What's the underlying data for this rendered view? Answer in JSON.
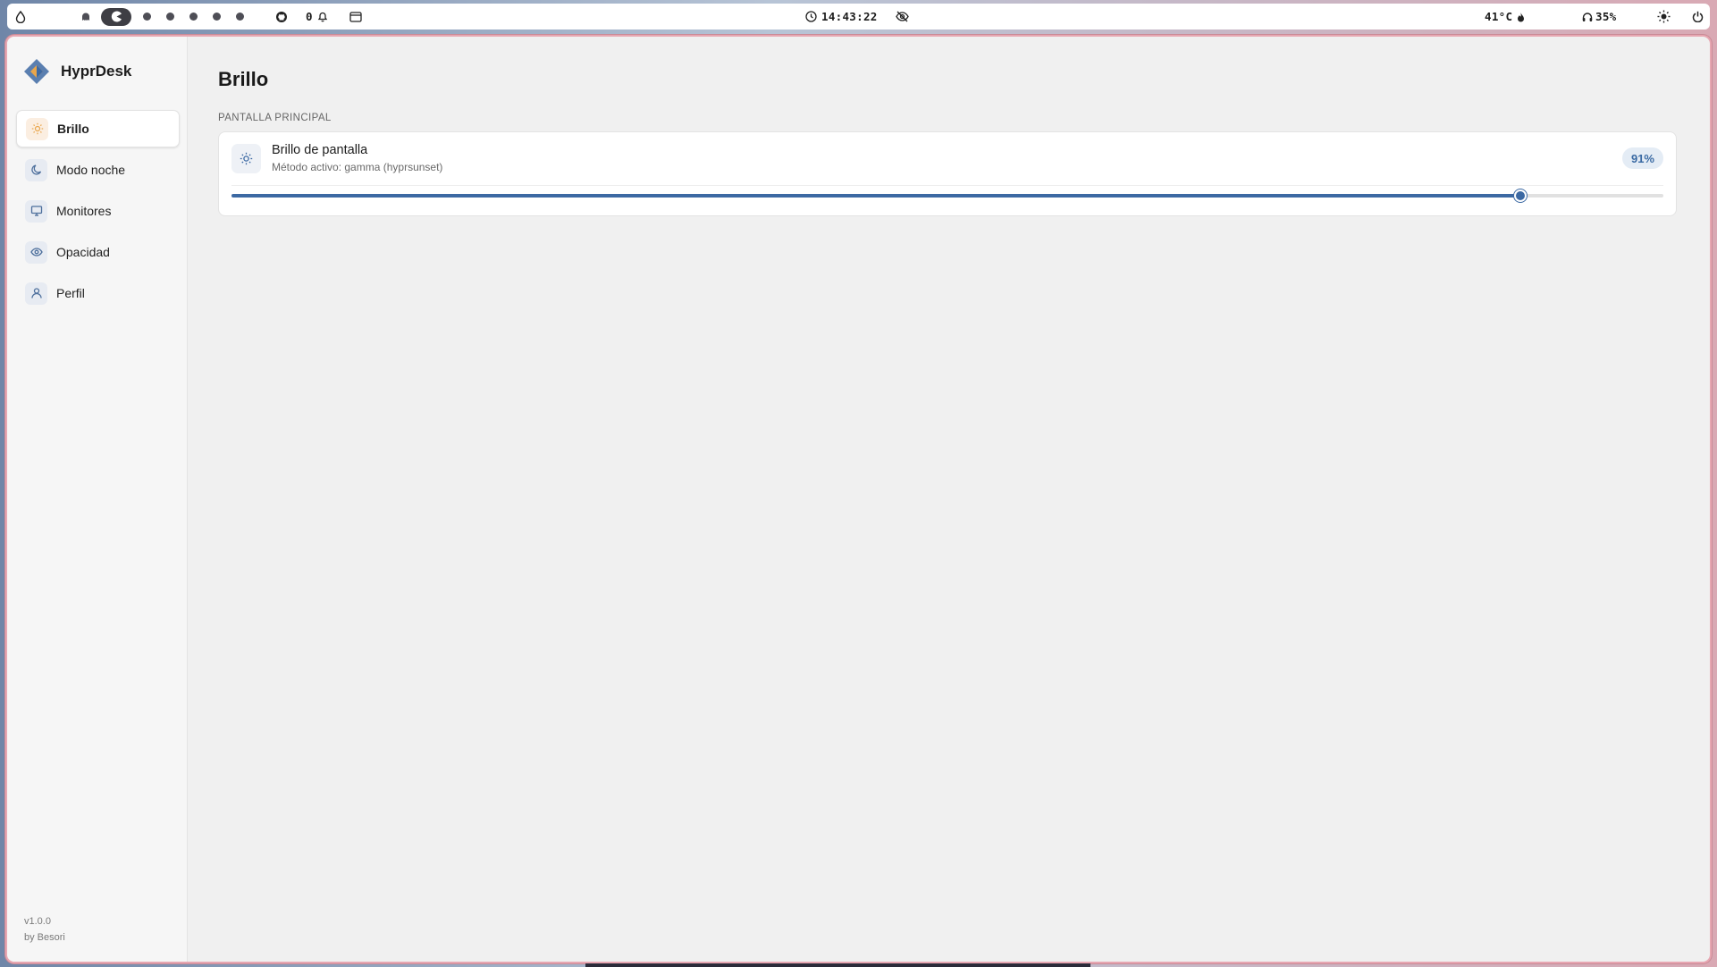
{
  "topbar": {
    "clock": "14:43:22",
    "notifications_count": "0",
    "temperature": "41°C",
    "volume": "35%",
    "workspaces": [
      "1",
      "2",
      "3",
      "4",
      "5",
      "6",
      "7"
    ],
    "active_workspace": "2",
    "icons": {
      "launcher": "water-drop-icon",
      "workspace_1": "ghost-icon",
      "workspace_active": "pacman-icon",
      "github": "github-icon",
      "bell": "bell-icon",
      "window": "window-icon",
      "clock": "clock-icon",
      "eye_off": "eye-off-icon",
      "flame": "flame-icon",
      "headphones": "headphones-icon",
      "brightness": "sun-icon",
      "power": "power-icon"
    }
  },
  "app": {
    "name": "HyprDesk",
    "version": "v1.0.0",
    "author": "by Besori"
  },
  "sidebar": {
    "items": [
      {
        "label": "Brillo",
        "icon": "sun-icon",
        "active": true
      },
      {
        "label": "Modo noche",
        "icon": "moon-icon",
        "active": false
      },
      {
        "label": "Monitores",
        "icon": "monitor-icon",
        "active": false
      },
      {
        "label": "Opacidad",
        "icon": "eye-icon",
        "active": false
      },
      {
        "label": "Perfil",
        "icon": "user-icon",
        "active": false
      }
    ]
  },
  "main": {
    "title": "Brillo",
    "section_label": "PANTALLA PRINCIPAL",
    "brightness_card": {
      "title": "Brillo de pantalla",
      "subtitle": "Método activo: gamma (hyprsunset)",
      "value_label": "91%",
      "value": 0.9
    }
  },
  "colors": {
    "accent": "#3c69a3",
    "badge_bg": "#e4ecf5",
    "active_icon_bg": "#fbeee1",
    "window_border": "#e7a7b2"
  }
}
